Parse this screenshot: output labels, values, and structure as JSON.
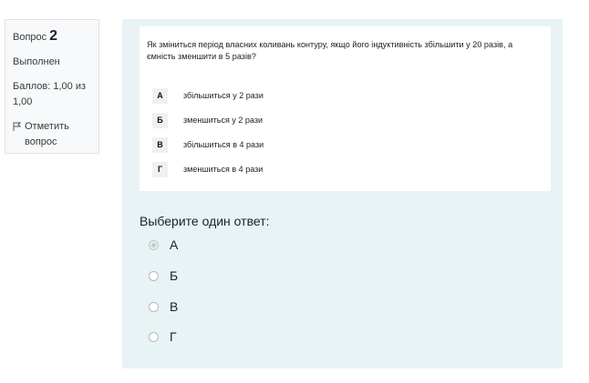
{
  "info": {
    "question_label": "Вопрос",
    "question_number": "2",
    "state": "Выполнен",
    "grade": "Баллов: 1,00 из 1,00",
    "flag_label": "Отметить вопрос"
  },
  "question": {
    "text": "Як зміниться період власних коливань контуру, якщо його індуктивність збільшити у 20 разів, а ємність зменшити в 5 разів?",
    "options": [
      {
        "letter": "А",
        "text": "збільшиться у 2 рази"
      },
      {
        "letter": "Б",
        "text": "зменшиться у 2 рази"
      },
      {
        "letter": "В",
        "text": "збільшиться в 4 рази"
      },
      {
        "letter": "Г",
        "text": "зменшиться в 4 рази"
      }
    ]
  },
  "prompt": "Выберите один ответ:",
  "answers": [
    {
      "label": "А",
      "state": "disabled-selected"
    },
    {
      "label": "Б",
      "state": "unselected"
    },
    {
      "label": "В",
      "state": "unselected"
    },
    {
      "label": "Г",
      "state": "unselected"
    }
  ],
  "colors": {
    "panel_background": "#e7f3f5",
    "info_background": "#f8f9fa",
    "info_border": "#dee2e6"
  },
  "icons": {
    "flag": "flag-outline-icon",
    "radio": "radio-circle-icon"
  }
}
